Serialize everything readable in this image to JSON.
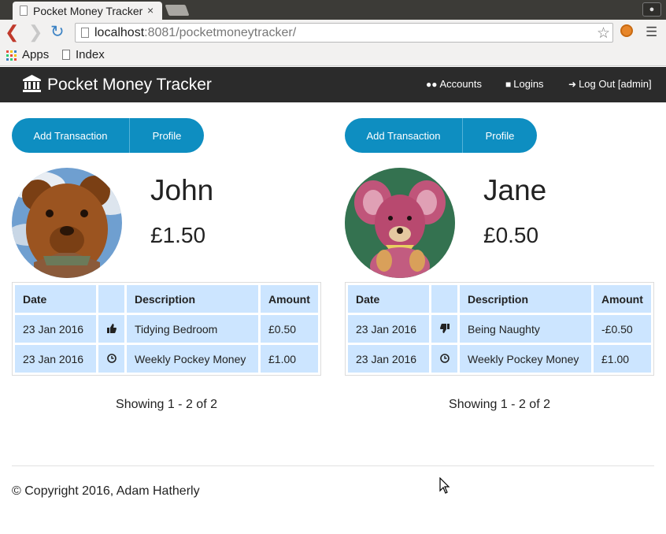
{
  "browser": {
    "tab_title": "Pocket Money Tracker",
    "tab_close": "×",
    "url_host": "localhost",
    "url_rest": ":8081/pocketmoneytracker/",
    "bookmarks": [
      {
        "label": "Apps",
        "icon": "apps-grid-icon"
      },
      {
        "label": "Index",
        "icon": "page-icon"
      }
    ]
  },
  "navbar": {
    "brand": "Pocket Money Tracker",
    "brand_icon": "bank-icon",
    "links": [
      {
        "label": "Accounts",
        "icon": "users-icon"
      },
      {
        "label": "Logins",
        "icon": "lock-icon"
      },
      {
        "label": "Log Out [admin]",
        "icon": "logout-icon"
      }
    ]
  },
  "children": [
    {
      "name": "John",
      "balance": "£1.50",
      "avatar": "teddy-bear-photo",
      "buttons": {
        "add": "Add Transaction",
        "profile": "Profile"
      },
      "columns": {
        "date": "Date",
        "description": "Description",
        "amount": "Amount"
      },
      "transactions": [
        {
          "date": "23 Jan 2016",
          "icon": "thumbs-up-icon",
          "description": "Tidying Bedroom",
          "amount": "£0.50",
          "negative": false
        },
        {
          "date": "23 Jan 2016",
          "icon": "clock-icon",
          "description": "Weekly Pockey Money",
          "amount": "£1.00",
          "negative": false
        }
      ],
      "showing": "Showing 1 - 2 of 2"
    },
    {
      "name": "Jane",
      "balance": "£0.50",
      "avatar": "crochet-mouse-photo",
      "buttons": {
        "add": "Add Transaction",
        "profile": "Profile"
      },
      "columns": {
        "date": "Date",
        "description": "Description",
        "amount": "Amount"
      },
      "transactions": [
        {
          "date": "23 Jan 2016",
          "icon": "thumbs-down-icon",
          "description": "Being Naughty",
          "amount": "-£0.50",
          "negative": true
        },
        {
          "date": "23 Jan 2016",
          "icon": "clock-icon",
          "description": "Weekly Pockey Money",
          "amount": "£1.00",
          "negative": false
        }
      ],
      "showing": "Showing 1 - 2 of 2"
    }
  ],
  "footer": {
    "copyright": "© Copyright 2016, Adam Hatherly"
  },
  "colors": {
    "navbar_bg": "#2b2b2b",
    "button_bg": "#0e8ec1",
    "table_cell_bg": "#cce5ff",
    "negative_amount": "#e01b24"
  }
}
